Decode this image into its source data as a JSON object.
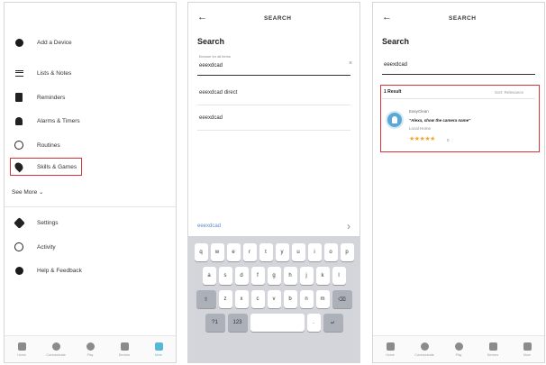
{
  "panel1": {
    "menu": [
      {
        "label": "Add a Device",
        "icon": "plus-circle-icon"
      },
      {
        "label": "Lists & Notes",
        "icon": "list-icon"
      },
      {
        "label": "Reminders",
        "icon": "clipboard-icon"
      },
      {
        "label": "Alarms & Timers",
        "icon": "bell-icon"
      },
      {
        "label": "Routines",
        "icon": "check-circle-icon"
      },
      {
        "label": "Skills & Games",
        "icon": "location-pin-icon"
      }
    ],
    "see_more": "See More",
    "lower": [
      {
        "label": "Settings",
        "icon": "gear-icon"
      },
      {
        "label": "Activity",
        "icon": "clock-icon"
      },
      {
        "label": "Help & Feedback",
        "icon": "help-icon"
      }
    ],
    "highlight_color": "#d9343b"
  },
  "panel2": {
    "back": "←",
    "title": "SEARCH",
    "heading": "Search",
    "field_label": "Browse for all items",
    "field_value": "eeexdcad",
    "clear": "×",
    "suggestions": [
      "eeexdcad direct",
      "eeexdcad"
    ],
    "kb_suggestion": "eeexdcad",
    "kb_arrow": "›",
    "keyboard": {
      "row1": [
        "q",
        "w",
        "e",
        "r",
        "t",
        "y",
        "u",
        "i",
        "o",
        "p"
      ],
      "row2": [
        "a",
        "s",
        "d",
        "f",
        "g",
        "h",
        "j",
        "k",
        "l"
      ],
      "row3": [
        "⇧",
        "z",
        "x",
        "c",
        "v",
        "b",
        "n",
        "m",
        "⌫"
      ],
      "row4": [
        "?1",
        "123",
        "",
        "",
        ".",
        " ↵ ",
        "↵"
      ]
    }
  },
  "panel3": {
    "back": "←",
    "title": "SEARCH",
    "heading": "Search",
    "search_value": "eeexdcad",
    "results_count": "1 Result",
    "sort": "Sort: Relevance",
    "skill_name": "EasyClean",
    "skill_phrase": "\"Alexa, show the camera name\"",
    "skill_dev": "Local Home",
    "stars": "★★★★★",
    "rating_count": "0"
  },
  "bottom_nav": [
    {
      "label": "Home",
      "icon": "home-icon"
    },
    {
      "label": "Communicate",
      "icon": "chat-icon"
    },
    {
      "label": "Play",
      "icon": "play-icon"
    },
    {
      "label": "Devices",
      "icon": "devices-icon"
    },
    {
      "label": "More",
      "icon": "menu-icon"
    }
  ]
}
